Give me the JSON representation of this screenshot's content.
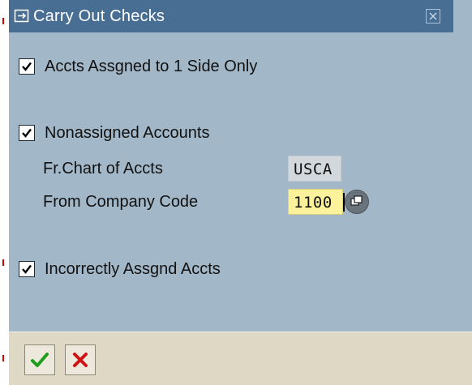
{
  "dialog": {
    "title": "Carry Out Checks",
    "title_icon": "dialog-arrow-icon",
    "close_icon": "close-icon"
  },
  "checks": [
    {
      "label": "Accts Assgned to 1 Side Only",
      "checked": true
    },
    {
      "label": "Nonassigned Accounts",
      "checked": true
    },
    {
      "label": "Incorrectly Assgnd Accts",
      "checked": true
    }
  ],
  "fields": {
    "chart_of_accts": {
      "label": "Fr.Chart of Accts",
      "value": "USCA"
    },
    "company_code": {
      "label": "From Company Code",
      "value": "1100",
      "help_icon": "value-help-icon"
    }
  },
  "footer": {
    "confirm_icon": "checkmark-icon",
    "cancel_icon": "cancel-x-icon"
  },
  "colors": {
    "dialog_bg": "#a2b8c9",
    "titlebar_bg": "#486f93",
    "input_bg": "#fdf29c",
    "readonly_bg": "#d3d8dc",
    "footer_bg": "#ded8c4",
    "confirm_green": "#1d9e1d",
    "cancel_red": "#d01414"
  }
}
